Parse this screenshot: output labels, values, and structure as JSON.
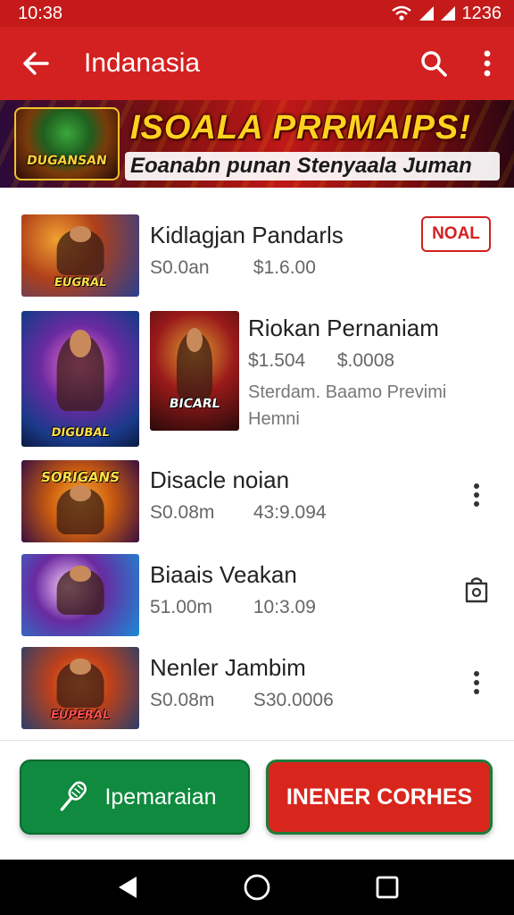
{
  "status_bar": {
    "time": "10:38",
    "right_text": "1236"
  },
  "app_bar": {
    "title": "Indanasia",
    "back_icon": "arrow-left-icon",
    "search_icon": "search-icon",
    "menu_icon": "more-vert-icon"
  },
  "banner": {
    "logo_text": "DUGANSAN",
    "headline": "ISOALA PRRMAIPS!",
    "subline": "Eoanabn punan Stenyaala Juman"
  },
  "items": [
    {
      "title": "Kidlagjan Pandarls",
      "meta_a": "S0.0an",
      "meta_b": "$1.6.00",
      "badge": "NOAL",
      "thumb_caption": "EUGRAL",
      "colors": [
        "#2a3f8f",
        "#d9702a"
      ]
    },
    {
      "title": "Riokan Pernaniam",
      "meta_a": "$1.504",
      "meta_b": "$.0008",
      "desc": "Sterdam. Baamo Previmi Hemni",
      "thumb_caption": "DIGUBAL",
      "thumb2_caption": "BICARL",
      "colors": [
        "#3b1a7a",
        "#1aa0d6"
      ]
    },
    {
      "title": "Disacle noian",
      "meta_a": "S0.08m",
      "meta_b": "43:9.094",
      "thumb_caption": "SORIGANS",
      "colors": [
        "#c85a10",
        "#3a1040"
      ]
    },
    {
      "title": "Biaais Veakan",
      "meta_a": "51.00m",
      "meta_b": "10:3.09",
      "thumb_caption": "",
      "colors": [
        "#6a2aa0",
        "#1a8ad6"
      ]
    },
    {
      "title": "Nenler Jambim",
      "meta_a": "S0.08m",
      "meta_b": "S30.0006",
      "thumb_caption": "EUPERAL",
      "colors": [
        "#2a3f6a",
        "#c0401a"
      ]
    }
  ],
  "buttons": {
    "primary": "Ipemaraian",
    "secondary": "INENER CORHES"
  },
  "colors": {
    "app_red": "#d32020",
    "green": "#0f8a3e",
    "button_red": "#d9261d"
  }
}
